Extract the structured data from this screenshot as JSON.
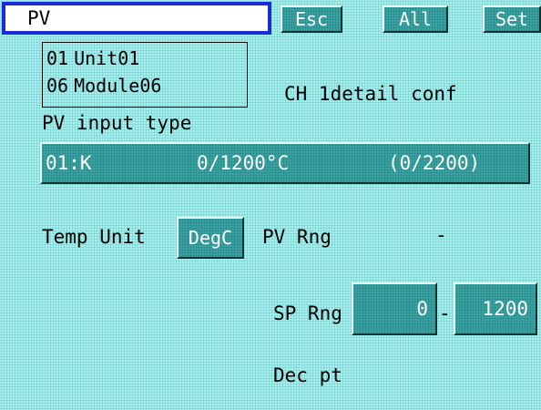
{
  "header": {
    "title": "PV",
    "esc_label": "Esc",
    "all_label": "All",
    "set_label": "Set"
  },
  "unit_box": {
    "line1_num": "01",
    "line1_name": "Unit01",
    "line2_num": "06",
    "line2_name": "Module06"
  },
  "channel_label": "CH 1detail conf",
  "pv_input": {
    "label": "PV input type",
    "code": "01:K",
    "range": "0/1200°C",
    "raw": "(0/2200)"
  },
  "temp_unit": {
    "label": "Temp Unit",
    "value": "DegC"
  },
  "pv_range": {
    "label": "PV Rng",
    "value": "-"
  },
  "sp_range": {
    "label": "SP Rng",
    "low": "0",
    "separator": "-",
    "high": "1200"
  },
  "dec_pt": {
    "label": "Dec pt"
  },
  "colors": {
    "background": "#a6f0f0",
    "button": "#3aa3a3",
    "title_border": "#1a2cd6",
    "button_text": "#ffffff"
  }
}
